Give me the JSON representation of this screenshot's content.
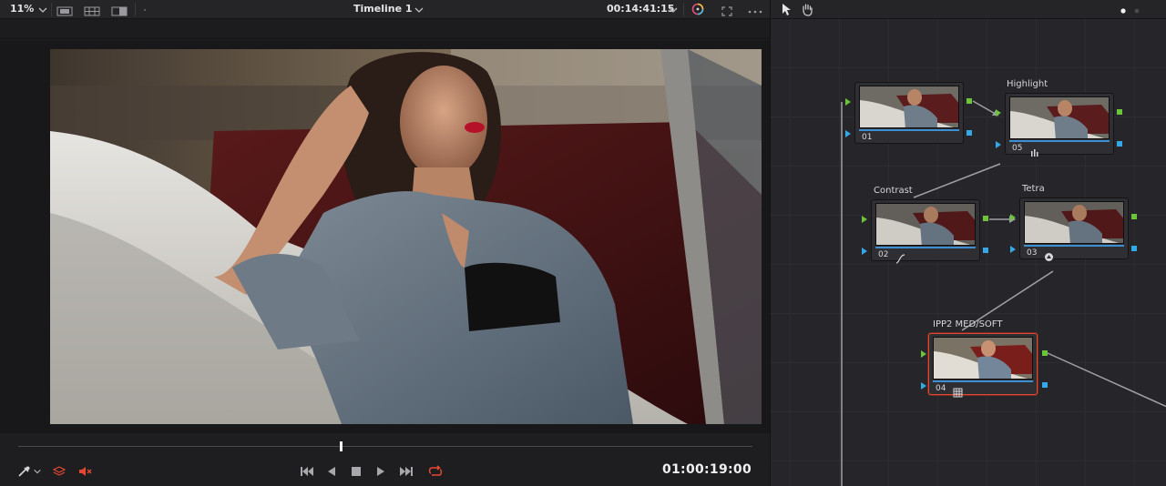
{
  "viewer": {
    "zoom": "11%",
    "timeline_name": "Timeline 1",
    "source_timecode": "00:14:41:15",
    "record_timecode": "01:00:19:00",
    "playhead_progress": 0.44
  },
  "icons": {
    "zoom_dropdown": "chevron-down-icon",
    "single_view": "single-viewer-icon",
    "split_view": "split-viewer-icon",
    "compare_view": "compare-viewer-icon",
    "timeline_dropdown": "chevron-down-icon",
    "timecode_dropdown": "chevron-down-icon",
    "color_wheel": "color-wheel-icon",
    "fullscreen": "fullscreen-icon",
    "more": "more-options-icon",
    "pointer": "pointer-icon",
    "hand": "hand-icon",
    "picker": "color-picker-icon",
    "layers": "layers-icon",
    "mute": "mute-icon",
    "first_frame": "skip-to-start-icon",
    "reverse": "play-reverse-icon",
    "stop": "stop-icon",
    "play": "play-icon",
    "last_frame": "skip-to-end-icon",
    "loop": "loop-icon"
  },
  "nodes": [
    {
      "id": "n01",
      "number": "01",
      "label": "",
      "icon": ""
    },
    {
      "id": "n05",
      "number": "05",
      "label": "Highlight",
      "icon": "bars-icon"
    },
    {
      "id": "n02",
      "number": "02",
      "label": "Contrast",
      "icon": "curve-icon"
    },
    {
      "id": "n03",
      "number": "03",
      "label": "Tetra",
      "icon": "lut-icon"
    },
    {
      "id": "n04",
      "number": "04",
      "label": "IPP2 MED/SOFT",
      "icon": "grid-icon",
      "selected": true
    }
  ],
  "colors": {
    "accent_red": "#e8472f",
    "node_green": "#6cc43a",
    "node_blue": "#35a8e8",
    "selected_node": "#d84a32"
  }
}
